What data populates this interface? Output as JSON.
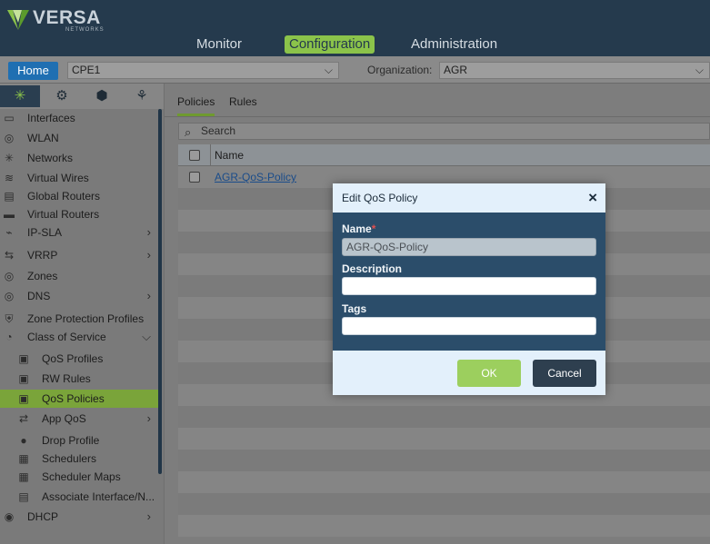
{
  "brand": {
    "name": "VERSA",
    "sub": "NETWORKS"
  },
  "nav": {
    "monitor": "Monitor",
    "configuration": "Configuration",
    "administration": "Administration"
  },
  "context": {
    "home": "Home",
    "device_value": "CPE1",
    "org_label": "Organization:",
    "org_value": "AGR"
  },
  "sidebar": {
    "items": [
      {
        "label": "Interfaces",
        "icon": "interfaces-icon",
        "glyph": "▭"
      },
      {
        "label": "WLAN",
        "icon": "wlan-icon",
        "glyph": "◎"
      },
      {
        "label": "Networks",
        "icon": "networks-icon",
        "glyph": "✳"
      },
      {
        "label": "Virtual Wires",
        "icon": "virtual-wires-icon",
        "glyph": "≋"
      },
      {
        "label": "Global Routers",
        "icon": "global-routers-icon",
        "glyph": "▤"
      },
      {
        "label": "Virtual Routers",
        "icon": "virtual-routers-icon",
        "glyph": "▬"
      },
      {
        "label": "IP-SLA",
        "icon": "ip-sla-icon",
        "glyph": "⌁"
      },
      {
        "label": "VRRP",
        "icon": "vrrp-icon",
        "glyph": "⇆"
      },
      {
        "label": "Zones",
        "icon": "zones-icon",
        "glyph": "◎"
      },
      {
        "label": "DNS",
        "icon": "dns-icon",
        "glyph": "◎"
      },
      {
        "label": "Zone Protection Profiles",
        "icon": "zone-protection-icon",
        "glyph": "⛨"
      },
      {
        "label": "Class of Service",
        "icon": "class-of-service-icon",
        "glyph": "◔"
      },
      {
        "label": "QoS Profiles",
        "icon": "qos-profiles-icon",
        "glyph": "▣"
      },
      {
        "label": "RW Rules",
        "icon": "rw-rules-icon",
        "glyph": "▣"
      },
      {
        "label": "QoS Policies",
        "icon": "qos-policies-icon",
        "glyph": "▣"
      },
      {
        "label": "App QoS",
        "icon": "app-qos-icon",
        "glyph": "⇄"
      },
      {
        "label": "Drop Profile",
        "icon": "drop-profile-icon",
        "glyph": "●"
      },
      {
        "label": "Schedulers",
        "icon": "schedulers-icon",
        "glyph": "▦"
      },
      {
        "label": "Scheduler Maps",
        "icon": "scheduler-maps-icon",
        "glyph": "▦"
      },
      {
        "label": "Associate Interface/N...",
        "icon": "associate-interface-icon",
        "glyph": "▤"
      },
      {
        "label": "DHCP",
        "icon": "dhcp-icon",
        "glyph": "◉"
      }
    ]
  },
  "content": {
    "tabs": {
      "policies": "Policies",
      "rules": "Rules"
    },
    "search_placeholder": "Search",
    "table": {
      "header_name": "Name",
      "rows": [
        {
          "name": "AGR-QoS-Policy"
        }
      ]
    }
  },
  "modal": {
    "title": "Edit QoS Policy",
    "close": "×",
    "name_label": "Name",
    "required_mark": "*",
    "name_value": "AGR-QoS-Policy",
    "description_label": "Description",
    "description_value": "",
    "tags_label": "Tags",
    "tags_value": "",
    "ok": "OK",
    "cancel": "Cancel"
  },
  "colors": {
    "header_bg": "#253a4d",
    "accent_green": "#8bc34a",
    "home_blue": "#1f6fb2",
    "modal_body": "#2b4d6a"
  }
}
